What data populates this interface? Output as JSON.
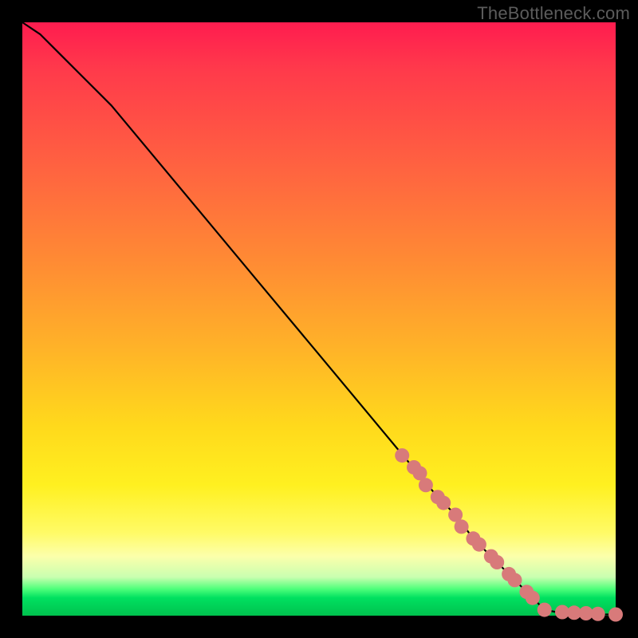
{
  "attribution": "TheBottleneck.com",
  "colors": {
    "frame_bg": "#000000",
    "gradient_top": "#ff1c4f",
    "gradient_mid": "#ffd91c",
    "gradient_bottom": "#00c24e",
    "curve": "#000000",
    "marker": "#d87a7a"
  },
  "chart_data": {
    "type": "line",
    "title": "",
    "xlabel": "",
    "ylabel": "",
    "xlim": [
      0,
      100
    ],
    "ylim": [
      0,
      100
    ],
    "series": [
      {
        "name": "curve",
        "x": [
          0,
          3,
          6,
          10,
          15,
          20,
          30,
          40,
          50,
          60,
          65,
          70,
          73,
          76,
          79,
          82,
          85,
          87,
          88,
          90,
          92,
          95,
          97,
          100
        ],
        "y": [
          100,
          98,
          95,
          91,
          86,
          80,
          68,
          56,
          44,
          32,
          26,
          20,
          17,
          13,
          10,
          7,
          4,
          2,
          1,
          0.6,
          0.4,
          0.3,
          0.2,
          0.2
        ]
      }
    ],
    "markers": {
      "name": "highlighted-points",
      "x": [
        64,
        66,
        67,
        68,
        70,
        71,
        73,
        74,
        76,
        77,
        79,
        80,
        82,
        83,
        85,
        86,
        88,
        91,
        93,
        95,
        97,
        100
      ],
      "y": [
        27,
        25,
        24,
        22,
        20,
        19,
        17,
        15,
        13,
        12,
        10,
        9,
        7,
        6,
        4,
        3,
        1,
        0.6,
        0.5,
        0.4,
        0.3,
        0.2
      ]
    }
  }
}
